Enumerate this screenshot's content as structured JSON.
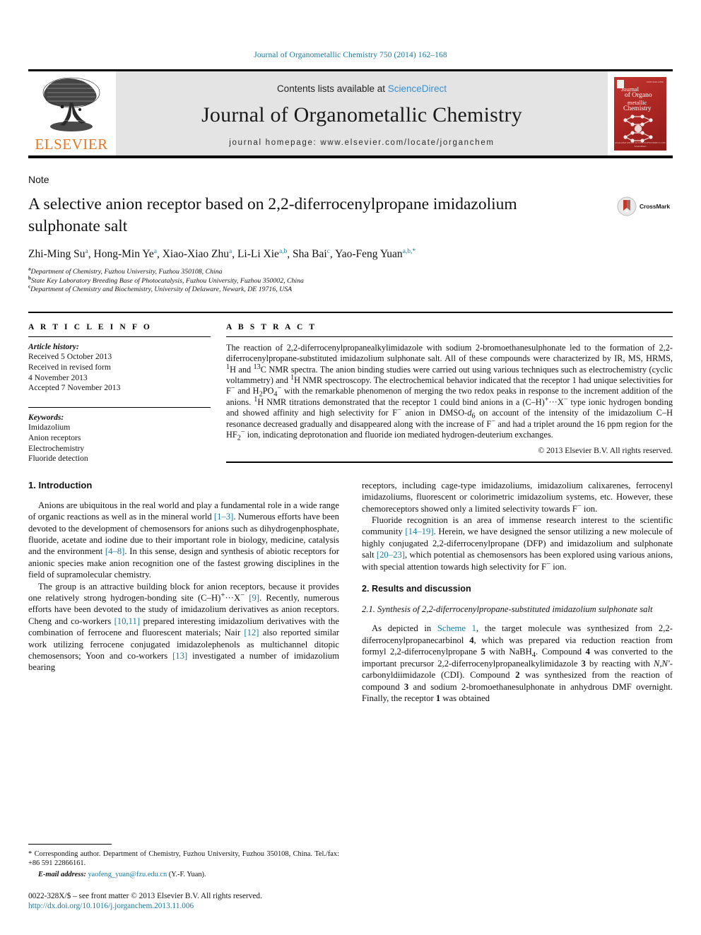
{
  "running_head": "Journal of Organometallic Chemistry 750 (2014) 162–168",
  "masthead": {
    "contents_prefix": "Contents lists available at ",
    "sciencedirect": "ScienceDirect",
    "journal_title": "Journal of Organometallic Chemistry",
    "homepage": "journal homepage: www.elsevier.com/locate/jorganchem",
    "publisher": "ELSEVIER",
    "publisher_color": "#E87722",
    "cover": {
      "line1": "Journal",
      "line2": "of Organo",
      "line3": "metallic",
      "line4": "Chemistry",
      "code": "ISSN 0022-328X",
      "footer1": "AVAILABLE ONLINE AT WWW.SCIENCEDIRECT.COM",
      "footer2": "ScienceDirect",
      "color": "#a92521"
    }
  },
  "article": {
    "type": "Note",
    "title": "A selective anion receptor based on 2,2-diferrocenylpropane imidazolium sulphonate salt",
    "crossmark_label": "CrossMark",
    "authors": [
      {
        "name": "Zhi-Ming Su",
        "sup": "a",
        "sep": ", "
      },
      {
        "name": "Hong-Min Ye",
        "sup": "a",
        "sep": ", "
      },
      {
        "name": "Xiao-Xiao Zhu",
        "sup": "a",
        "sep": ", "
      },
      {
        "name": "Li-Li Xie",
        "sup": "a,b",
        "sep": ", "
      },
      {
        "name": "Sha Bai",
        "sup": "c",
        "sep": ", "
      },
      {
        "name": "Yao-Feng Yuan",
        "sup": "a,b,*",
        "sep": ""
      }
    ],
    "affiliations": [
      {
        "sup": "a",
        "text": "Department of Chemistry, Fuzhou University, Fuzhou 350108, China"
      },
      {
        "sup": "b",
        "text": "State Key Laboratory Breeding Base of Photocatalysis, Fuzhou University, Fuzhou 350002, China"
      },
      {
        "sup": "c",
        "text": "Department of Chemistry and Biochemistry, University of Delaware, Newark, DE 19716, USA"
      }
    ]
  },
  "article_info": {
    "heading": "A R T I C L E   I N F O",
    "history_label": "Article history:",
    "history": [
      "Received 5 October 2013",
      "Received in revised form",
      "4 November 2013",
      "Accepted 7 November 2013"
    ],
    "keywords_label": "Keywords:",
    "keywords": [
      "Imidazolium",
      "Anion receptors",
      "Electrochemistry",
      "Fluoride detection"
    ]
  },
  "abstract": {
    "heading": "A B S T R A C T",
    "text_html": "The reaction of 2,2-diferrocenylpropanealkylimidazole with sodium 2-bromoethanesulphonate led to the formation of 2,2-diferrocenylpropane-substituted imidazolium sulphonate salt. All of these compounds were characterized by IR, MS, HRMS, <sup>1</sup>H and <sup>13</sup>C NMR spectra. The anion binding studies were carried out using various techniques such as electrochemistry (cyclic voltammetry) and <sup>1</sup>H NMR spectroscopy. The electrochemical behavior indicated that the receptor 1 had unique selectivities for F<sup>−</sup> and H<sub>2</sub>PO<sub>4</sub><sup>−</sup> with the remarkable phenomenon of merging the two redox peaks in response to the increment addition of the anions. <sup>1</sup>H NMR titrations demonstrated that the receptor 1 could bind anions in a (C–H)<sup>+</sup>···X<sup>−</sup> type ionic hydrogen bonding and showed affinity and high selectivity for F<sup>−</sup> anion in DMSO-<i>d</i><sub>6</sub> on account of the intensity of the imidazolium C–H resonance decreased gradually and disappeared along with the increase of F<sup>−</sup> and had a triplet around the 16 ppm region for the HF<sub>2</sub><sup>−</sup> ion, indicating deprotonation and fluoride ion mediated hydrogen-deuterium exchanges.",
    "copyright": "© 2013 Elsevier B.V. All rights reserved."
  },
  "body": {
    "intro_heading": "1. Introduction",
    "left_paragraphs_html": [
      "Anions are ubiquitous in the real world and play a fundamental role in a wide range of organic reactions as well as in the mineral world <span class=\"lnk\">[1–3]</span>. Numerous efforts have been devoted to the development of chemosensors for anions such as dihydrogenphosphate, fluoride, acetate and iodine due to their important role in biology, medicine, catalysis and the environment <span class=\"lnk\">[4–8]</span>. In this sense, design and synthesis of abiotic receptors for anionic species make anion recognition one of the fastest growing disciplines in the field of supramolecular chemistry.",
      "The group is an attractive building block for anion receptors, because it provides one relatively strong hydrogen-bonding site (C–H)<sup>+</sup>···X<sup>−</sup> <span class=\"lnk\">[9]</span>. Recently, numerous efforts have been devoted to the study of imidazolium derivatives as anion receptors. Cheng and co-workers <span class=\"lnk\">[10,11]</span> prepared interesting imidazolium derivatives with the combination of ferrocene and fluorescent materials; Nair <span class=\"lnk\">[12]</span> also reported similar work utilizing ferrocene conjugated imidazolephenols as multichannel ditopic chemosensors; Yoon and co-workers <span class=\"lnk\">[13]</span> investigated a number of imidazolium bearing"
    ],
    "right_paragraphs_html": [
      "receptors, including cage-type imidazoliums, imidazolium calixarenes, ferrocenyl imidazoliums, fluorescent or colorimetric imidazolium systems, etc. However, these chemoreceptors showed only a limited selectivity towards F<sup>−</sup> ion.",
      "Fluoride recognition is an area of immense research interest to the scientific community <span class=\"lnk\">[14–19]</span>. Herein, we have designed the sensor utilizing a new molecule of highly conjugated 2,2-diferrocenylpropane (DFP) and imidazolium and sulphonate salt <span class=\"lnk\">[20–23]</span>, which potential as chemosensors has been explored using various anions, with special attention towards high selectivity for F<sup>−</sup> ion."
    ],
    "results_heading": "2. Results and discussion",
    "subsection_heading": "2.1. Synthesis of 2,2-diferrocenylpropane-substituted imidazolium sulphonate salt",
    "results_paragraph_html": "As depicted in <span class=\"lnk\">Scheme 1</span>, the target molecule was synthesized from 2,2-diferrocenylpropanecarbinol <b>4</b>, which was prepared via reduction reaction from formyl 2,2-diferrocenylpropane <b>5</b> with NaBH<sub>4</sub>. Compound <b>4</b> was converted to the important precursor 2,2-diferrocenylpropanealkylimidazole <b>3</b> by reacting with <i>N,N′</i>-carbonyldiimidazole (CDI). Compound <b>2</b> was synthesized from the reaction of compound <b>3</b> and sodium 2-bromoethanesulphonate in anhydrous DMF overnight. Finally, the receptor <b>1</b> was obtained"
  },
  "footer": {
    "corresponding_html": "* Corresponding author. Department of Chemistry, Fuzhou University, Fuzhou 350108, China. Tel./fax: +86 591 22866161.",
    "email_label": "E-mail address:",
    "email": "yaofeng_yuan@fzu.edu.cn",
    "email_attribution": "(Y.-F. Yuan).",
    "issn_line": "0022-328X/$ – see front matter © 2013 Elsevier B.V. All rights reserved.",
    "doi": "http://dx.doi.org/10.1016/j.jorganchem.2013.11.006"
  },
  "colors": {
    "link": "#1a7a9e",
    "sciencedirect": "#3a8fd0",
    "elsevier_orange": "#E87722"
  }
}
